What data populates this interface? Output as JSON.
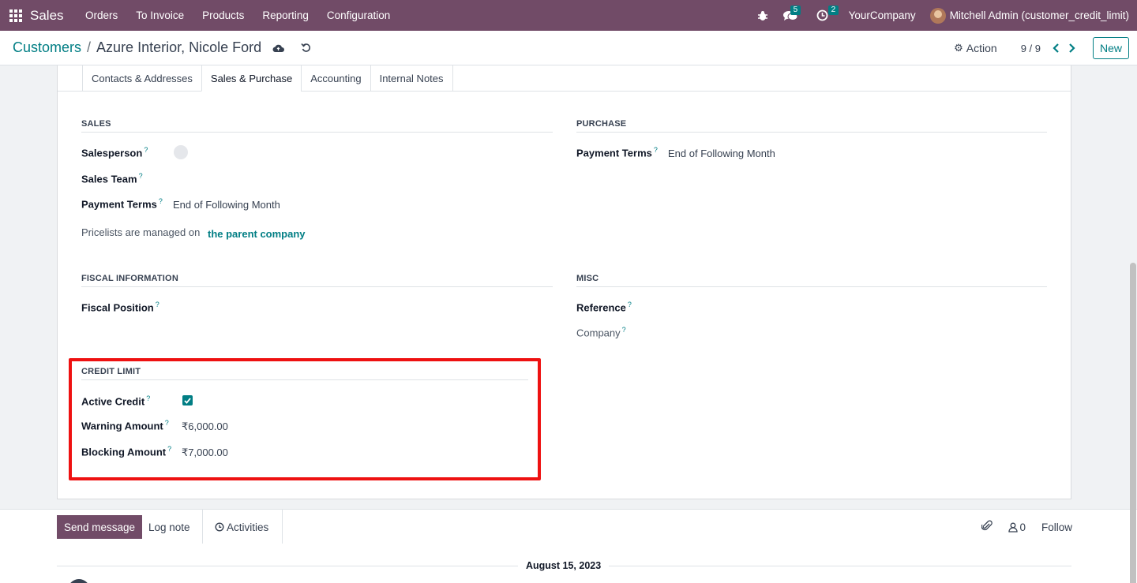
{
  "navbar": {
    "brand": "Sales",
    "menu": [
      "Orders",
      "To Invoice",
      "Products",
      "Reporting",
      "Configuration"
    ],
    "messages_count": "5",
    "activities_count": "2",
    "company": "YourCompany",
    "user": "Mitchell Admin (customer_credit_limit)",
    "color": "#714b67"
  },
  "control": {
    "breadcrumb_root": "Customers",
    "breadcrumb_separator": "/",
    "breadcrumb_current": "Azure Interior, Nicole Ford",
    "action_label": "Action",
    "pager": "9 / 9",
    "new_label": "New"
  },
  "tabs": [
    "Contacts & Addresses",
    "Sales & Purchase",
    "Accounting",
    "Internal Notes"
  ],
  "active_tab": "Sales & Purchase",
  "sales": {
    "title": "SALES",
    "salesperson_label": "Salesperson",
    "sales_team_label": "Sales Team",
    "payment_terms_label": "Payment Terms",
    "payment_terms_value": "End of Following Month",
    "pricelist_text": "Pricelists are managed on",
    "pricelist_link": "the parent company"
  },
  "purchase": {
    "title": "PURCHASE",
    "payment_terms_label": "Payment Terms",
    "payment_terms_value": "End of Following Month"
  },
  "fiscal": {
    "title": "FISCAL INFORMATION",
    "fiscal_position_label": "Fiscal Position"
  },
  "misc": {
    "title": "MISC",
    "reference_label": "Reference",
    "company_label": "Company"
  },
  "credit_limit": {
    "title": "CREDIT LIMIT",
    "active_credit_label": "Active Credit",
    "active_credit_checked": true,
    "warning_label": "Warning Amount",
    "warning_value": "₹6,000.00",
    "blocking_label": "Blocking Amount",
    "blocking_value": "₹7,000.00"
  },
  "chatter": {
    "send_message": "Send message",
    "log_note": "Log note",
    "activities": "Activities",
    "followers_count": "0",
    "follow": "Follow",
    "date": "August 15, 2023"
  },
  "help_mark": "?",
  "accent_color": "#017e84"
}
